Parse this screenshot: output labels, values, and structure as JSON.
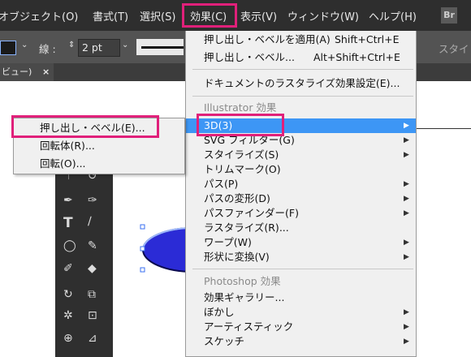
{
  "menubar": {
    "items": [
      "オブジェクト(O)",
      "書式(T)",
      "選択(S)",
      "効果(C)",
      "表示(V)",
      "ウィンドウ(W)",
      "ヘルプ(H)"
    ],
    "bridge_label": "Br"
  },
  "control_bar": {
    "stroke_label": "線 :",
    "stroke_value": "2 pt",
    "style_label": "スタイ"
  },
  "document_tab": {
    "title": "ビュー)",
    "close": "×"
  },
  "effect_menu": {
    "apply_last": "押し出し・ベベルを適用(A)",
    "apply_last_shortcut": "Shift+Ctrl+E",
    "last_effect": "押し出し・ベベル...",
    "last_effect_shortcut": "Alt+Shift+Ctrl+E",
    "doc_raster": "ドキュメントのラスタライズ効果設定(E)...",
    "illustrator_header": "Illustrator 効果",
    "illustrator_items": [
      "3D(3)",
      "SVG フィルター(G)",
      "スタイライズ(S)",
      "トリムマーク(O)",
      "パス(P)",
      "パスの変形(D)",
      "パスファインダー(F)",
      "ラスタライズ(R)...",
      "ワープ(W)",
      "形状に変換(V)"
    ],
    "photoshop_header": "Photoshop 効果",
    "photoshop_items": [
      "効果ギャラリー...",
      "ぼかし",
      "アーティスティック",
      "スケッチ"
    ]
  },
  "submenu_3d": {
    "items": [
      "押し出し・ベベル(E)...",
      "回転体(R)...",
      "回転(O)..."
    ]
  },
  "colors": {
    "highlight_box": "#e0207a",
    "menu_selection": "#3d96f5",
    "ellipse_fill": "#2b2bd6",
    "ellipse_stroke": "#0a0a50"
  }
}
